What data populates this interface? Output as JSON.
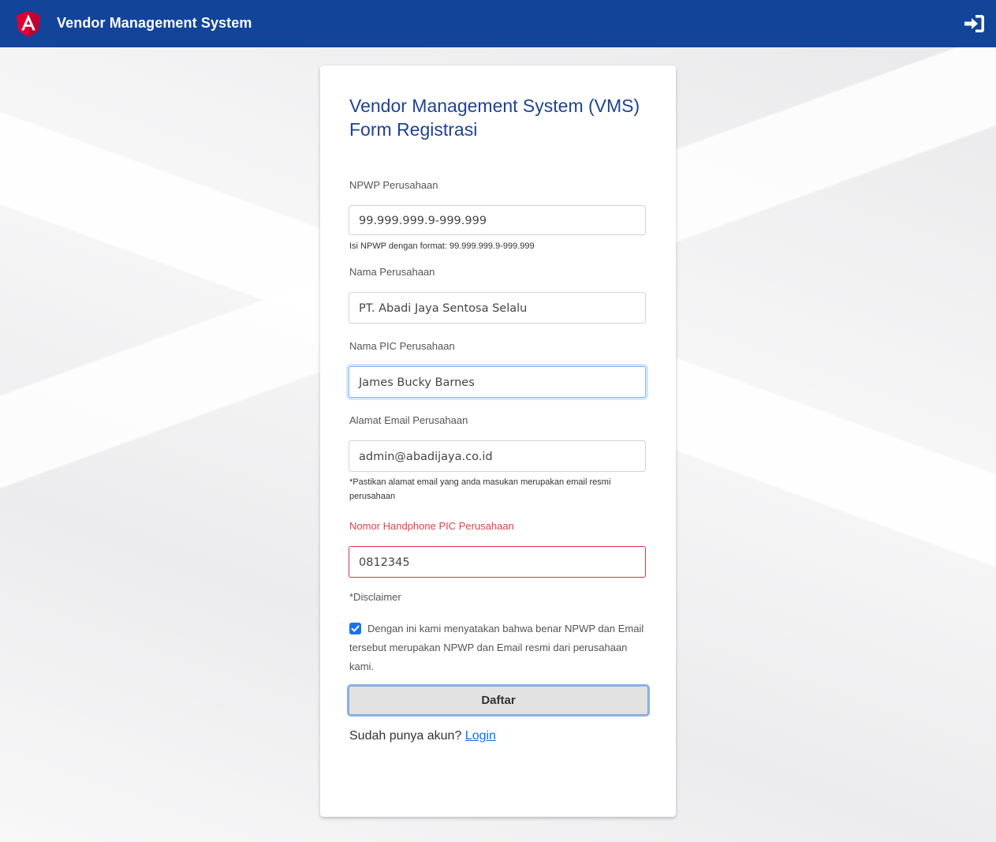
{
  "app": {
    "title": "Vendor Management System",
    "brand_color": "#12449a",
    "logo_icon": "angular-logo-icon",
    "login_icon": "sign-in-icon"
  },
  "form": {
    "heading_line1": "Vendor Management System (VMS)",
    "heading_line2": "Form Registrasi",
    "npwp": {
      "label": "NPWP Perusahaan",
      "value": "99.999.999.9-999.999",
      "help": "Isi NPWP dengan format: 99.999.999.9-999.999"
    },
    "company_name": {
      "label": "Nama Perusahaan",
      "value": "PT. Abadi Jaya Sentosa Selalu"
    },
    "pic_name": {
      "label": "Nama PIC Perusahaan",
      "value": "James Bucky Barnes"
    },
    "email": {
      "label": "Alamat Email Perusahaan",
      "value": "admin@abadijaya.co.id",
      "help": "*Pastikan alamat email yang anda masukan merupakan email resmi perusahaan"
    },
    "phone": {
      "label": "Nomor Handphone PIC Perusahaan",
      "value": "0812345",
      "state": "invalid"
    },
    "disclaimer": {
      "title": "*Disclaimer",
      "checked": true,
      "text": "Dengan ini kami menyatakan bahwa benar NPWP dan Email tersebut merupakan NPWP dan Email resmi dari perusahaan kami."
    },
    "submit_label": "Daftar",
    "footer_text": "Sudah punya akun?",
    "footer_link": "Login"
  }
}
